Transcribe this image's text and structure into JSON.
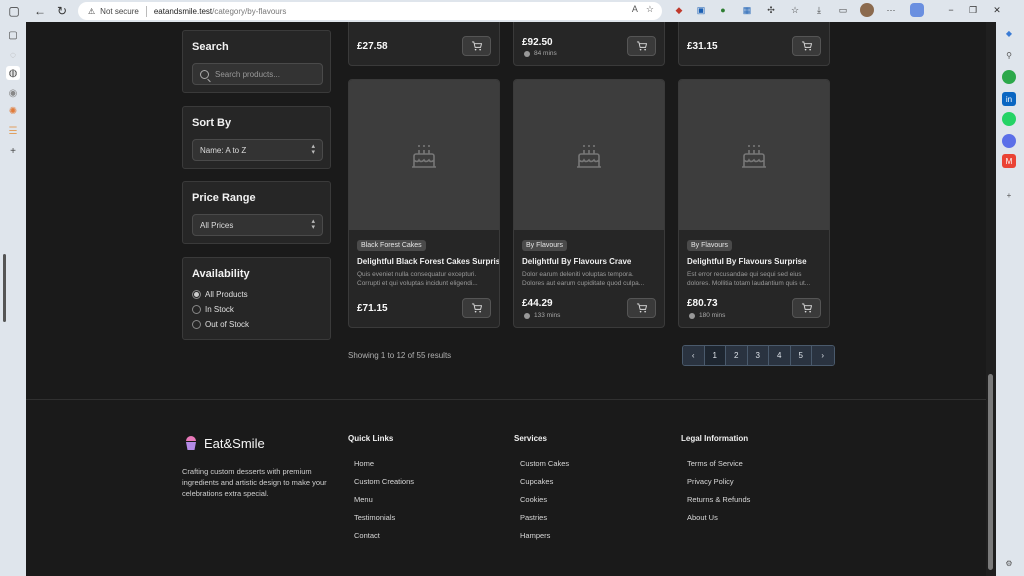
{
  "browser": {
    "not_secure": "Not secure",
    "url_host": "eatandsmile.test",
    "url_path": "/category/by-flavours"
  },
  "sidebar": {
    "search": {
      "title": "Search",
      "placeholder": "Search products..."
    },
    "sort": {
      "title": "Sort By",
      "value": "Name: A to Z"
    },
    "price": {
      "title": "Price Range",
      "value": "All Prices"
    },
    "availability": {
      "title": "Availability",
      "options": [
        "All Products",
        "In Stock",
        "Out of Stock"
      ],
      "selected": "All Products"
    }
  },
  "top_row": [
    {
      "price": "£27.58",
      "mins": ""
    },
    {
      "price": "£92.50",
      "mins": "84 mins"
    },
    {
      "price": "£31.15",
      "mins": ""
    }
  ],
  "products": [
    {
      "badge": "Black Forest Cakes",
      "title": "Delightful Black Forest Cakes Surprise",
      "desc": "Quis eveniet nulla consequatur excepturi. Corrupti et qui voluptas incidunt eligendi...",
      "price": "£71.15",
      "mins": ""
    },
    {
      "badge": "By Flavours",
      "title": "Delightful By Flavours Crave",
      "desc": "Dolor earum deleniti voluptas tempora. Dolores aut earum cupiditate quod culpa...",
      "price": "£44.29",
      "mins": "133 mins"
    },
    {
      "badge": "By Flavours",
      "title": "Delightful By Flavours Surprise",
      "desc": "Est error recusandae qui sequi sed eius dolores. Mollitia totam laudantium quis ut...",
      "price": "£80.73",
      "mins": "180 mins"
    }
  ],
  "results": {
    "text": "Showing 1 to 12 of 55 results"
  },
  "pagination": {
    "prev": "‹",
    "pages": [
      "1",
      "2",
      "3",
      "4",
      "5"
    ],
    "next": "›",
    "current": "1"
  },
  "footer": {
    "brand": "Eat&Smile",
    "tagline": "Crafting custom desserts with premium ingredients and artistic design to make your celebrations extra special.",
    "quick_links": {
      "title": "Quick Links",
      "items": [
        "Home",
        "Custom Creations",
        "Menu",
        "Testimonials",
        "Contact"
      ]
    },
    "services": {
      "title": "Services",
      "items": [
        "Custom Cakes",
        "Cupcakes",
        "Cookies",
        "Pastries",
        "Hampers"
      ]
    },
    "legal": {
      "title": "Legal Information",
      "items": [
        "Terms of Service",
        "Privacy Policy",
        "Returns & Refunds",
        "About Us"
      ]
    }
  },
  "colors": {
    "page_bg": "#1a1a1a",
    "card_bg": "#262626",
    "pager_bg": "#2a3340",
    "brand_pink": "#e879b9"
  },
  "icons": [
    "cart-icon",
    "cake-icon",
    "search-icon",
    "clock-icon",
    "chevron-left-icon",
    "chevron-right-icon"
  ]
}
